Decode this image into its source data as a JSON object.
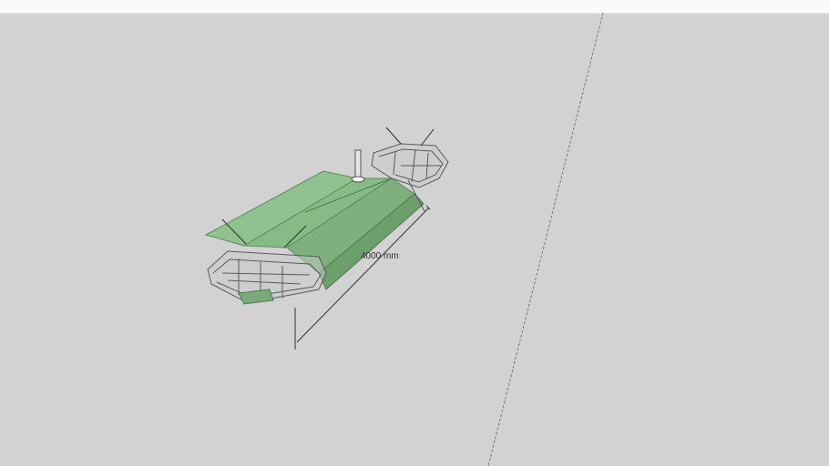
{
  "viewport": {
    "background": "#d2d2d2",
    "model": {
      "panel_color": "#8fbf8f",
      "panel_dark": "#6ea46e",
      "frame_color": "#6b6b6b"
    },
    "dimension": {
      "label": "4000 mm"
    }
  }
}
